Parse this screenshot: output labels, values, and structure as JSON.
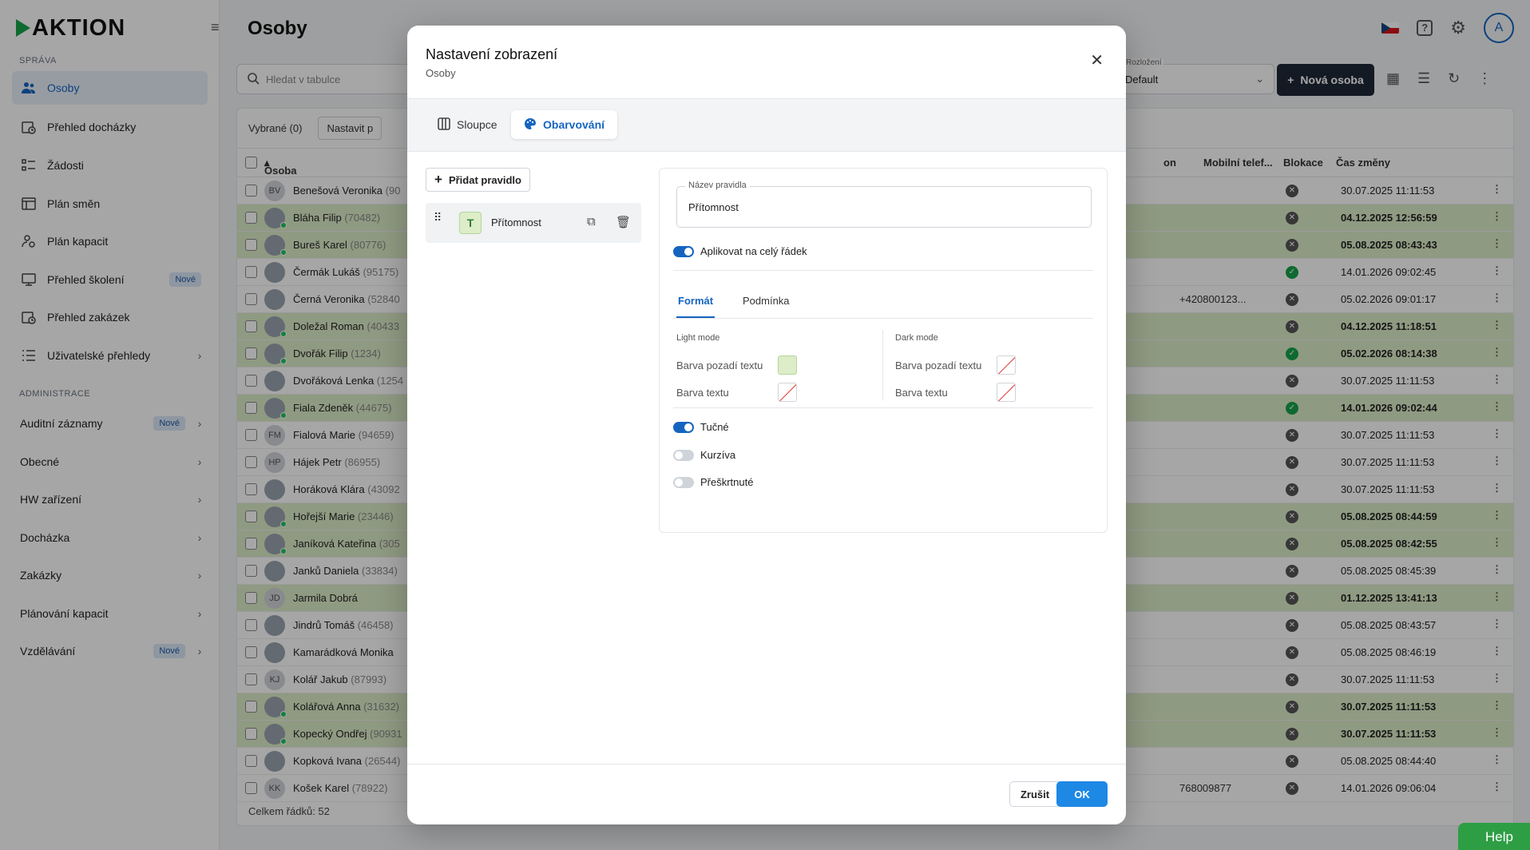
{
  "brand": {
    "logo_text": "AKTION"
  },
  "sidebar": {
    "section_sprava": "SPRÁVA",
    "items": [
      {
        "label": "Osoby"
      },
      {
        "label": "Přehled docházky"
      },
      {
        "label": "Žádosti"
      },
      {
        "label": "Plán směn"
      },
      {
        "label": "Plán kapacit"
      },
      {
        "label": "Přehled školení",
        "badge": "Nové"
      },
      {
        "label": "Přehled zakázek"
      },
      {
        "label": "Uživatelské přehledy"
      }
    ],
    "section_admin": "ADMINISTRACE",
    "admin_items": [
      {
        "label": "Auditní záznamy",
        "badge": "Nové"
      },
      {
        "label": "Obecné"
      },
      {
        "label": "HW zařízení"
      },
      {
        "label": "Docházka"
      },
      {
        "label": "Zakázky"
      },
      {
        "label": "Plánování kapacit"
      },
      {
        "label": "Vzdělávání",
        "badge": "Nové"
      }
    ]
  },
  "header": {
    "title": "Osoby",
    "avatar_initial": "A"
  },
  "toolbar": {
    "search_placeholder": "Hledat v tabulce",
    "layout_caption": "Rozložení",
    "layout_value": "Default",
    "new_button": "Nová osoba"
  },
  "table": {
    "selected_label": "Vybrané (0)",
    "set_label": "Nastavit p",
    "columns": {
      "person": "Osoba",
      "mobile": "Mobilní telef...",
      "block": "Blokace",
      "time": "Čas změny",
      "hidden": "on"
    },
    "rows": [
      {
        "initials": "BV",
        "name": "Benešová Veronika",
        "id": "(90",
        "hl": false,
        "blk": "x",
        "time": "30.07.2025 11:11:53",
        "mobile": "",
        "online": false
      },
      {
        "initials": "",
        "name": "Bláha Filip",
        "id": "(70482)",
        "hl": true,
        "blk": "x",
        "time": "04.12.2025 12:56:59",
        "mobile": "",
        "online": true
      },
      {
        "initials": "",
        "name": "Bureš Karel",
        "id": "(80776)",
        "hl": true,
        "blk": "x",
        "time": "05.08.2025 08:43:43",
        "mobile": "",
        "online": true
      },
      {
        "initials": "",
        "name": "Čermák Lukáš",
        "id": "(95175)",
        "hl": false,
        "blk": "ok",
        "time": "14.01.2026 09:02:45",
        "mobile": "",
        "online": false
      },
      {
        "initials": "",
        "name": "Černá Veronika",
        "id": "(52840",
        "hl": false,
        "blk": "x",
        "time": "05.02.2026 09:01:17",
        "mobile": "+420800123...",
        "online": false
      },
      {
        "initials": "",
        "name": "Doležal Roman",
        "id": "(40433",
        "hl": true,
        "blk": "x",
        "time": "04.12.2025 11:18:51",
        "mobile": "",
        "online": true
      },
      {
        "initials": "",
        "name": "Dvořák Filip",
        "id": "(1234)",
        "hl": true,
        "blk": "ok",
        "time": "05.02.2026 08:14:38",
        "mobile": "",
        "online": true
      },
      {
        "initials": "",
        "name": "Dvořáková Lenka",
        "id": "(1254",
        "hl": false,
        "blk": "x",
        "time": "30.07.2025 11:11:53",
        "mobile": "",
        "online": false
      },
      {
        "initials": "",
        "name": "Fiala Zdeněk",
        "id": "(44675)",
        "hl": true,
        "blk": "ok",
        "time": "14.01.2026 09:02:44",
        "mobile": "",
        "online": true
      },
      {
        "initials": "FM",
        "name": "Fialová Marie",
        "id": "(94659)",
        "hl": false,
        "blk": "x",
        "time": "30.07.2025 11:11:53",
        "mobile": "",
        "online": false
      },
      {
        "initials": "HP",
        "name": "Hájek Petr",
        "id": "(86955)",
        "hl": false,
        "blk": "x",
        "time": "30.07.2025 11:11:53",
        "mobile": "",
        "online": false
      },
      {
        "initials": "",
        "name": "Horáková Klára",
        "id": "(43092",
        "hl": false,
        "blk": "x",
        "time": "30.07.2025 11:11:53",
        "mobile": "",
        "online": false
      },
      {
        "initials": "",
        "name": "Hořejší Marie",
        "id": "(23446)",
        "hl": true,
        "blk": "x",
        "time": "05.08.2025 08:44:59",
        "mobile": "",
        "online": true
      },
      {
        "initials": "",
        "name": "Janíková Kateřina",
        "id": "(305",
        "hl": true,
        "blk": "x",
        "time": "05.08.2025 08:42:55",
        "mobile": "",
        "online": true
      },
      {
        "initials": "",
        "name": "Janků Daniela",
        "id": "(33834)",
        "hl": false,
        "blk": "x",
        "time": "05.08.2025 08:45:39",
        "mobile": "",
        "online": false
      },
      {
        "initials": "JD",
        "name": "Jarmila Dobrá",
        "id": "",
        "hl": true,
        "blk": "x",
        "time": "01.12.2025 13:41:13",
        "mobile": "",
        "online": false
      },
      {
        "initials": "",
        "name": "Jindrů Tomáš",
        "id": "(46458)",
        "hl": false,
        "blk": "x",
        "time": "05.08.2025 08:43:57",
        "mobile": "",
        "online": false
      },
      {
        "initials": "",
        "name": "Kamarádková Monika",
        "id": "",
        "hl": false,
        "blk": "x",
        "time": "05.08.2025 08:46:19",
        "mobile": "",
        "online": false
      },
      {
        "initials": "KJ",
        "name": "Kolář Jakub",
        "id": "(87993)",
        "hl": false,
        "blk": "x",
        "time": "30.07.2025 11:11:53",
        "mobile": "",
        "online": false
      },
      {
        "initials": "",
        "name": "Kolářová Anna",
        "id": "(31632)",
        "hl": true,
        "blk": "x",
        "time": "30.07.2025 11:11:53",
        "mobile": "",
        "online": true
      },
      {
        "initials": "",
        "name": "Kopecký Ondřej",
        "id": "(90931",
        "hl": true,
        "blk": "x",
        "time": "30.07.2025 11:11:53",
        "mobile": "",
        "online": true
      },
      {
        "initials": "",
        "name": "Kopková Ivana",
        "id": "(26544)",
        "hl": false,
        "blk": "x",
        "time": "05.08.2025 08:44:40",
        "mobile": "",
        "online": false
      },
      {
        "initials": "KK",
        "name": "Košek Karel",
        "id": "(78922)",
        "hl": false,
        "blk": "x",
        "time": "14.01.2026 09:06:04",
        "mobile": "768009877",
        "online": false
      }
    ],
    "footer": "Celkem řádků: 52"
  },
  "modal": {
    "title": "Nastavení zobrazení",
    "subtitle": "Osoby",
    "tab_columns": "Sloupce",
    "tab_coloring": "Obarvování",
    "add_rule": "Přidat pravidlo",
    "rule": {
      "icon_letter": "T",
      "name": "Přítomnost"
    },
    "rule_name_caption": "Název pravidla",
    "rule_name_value": "Přítomnost",
    "apply_row": "Aplikovat na celý řádek",
    "format_tab": "Formát",
    "condition_tab": "Podmínka",
    "light_mode": "Light mode",
    "dark_mode": "Dark mode",
    "bg_color": "Barva pozadí textu",
    "text_color": "Barva textu",
    "bold": "Tučné",
    "italic": "Kurzíva",
    "strike": "Přeškrtnuté",
    "cancel": "Zrušit",
    "ok": "OK"
  },
  "help": "Help",
  "colors": {
    "accent": "#1565c0",
    "highlight": "#dcedc8",
    "help": "#2e9e44"
  }
}
